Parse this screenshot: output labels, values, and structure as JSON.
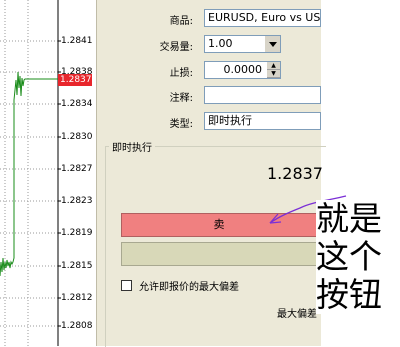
{
  "chart": {
    "tick_labels": [
      "1.2841",
      "1.2838",
      "1.2834",
      "1.2830",
      "1.2827",
      "1.2823",
      "1.2819",
      "1.2815",
      "1.2812",
      "1.2808"
    ],
    "current_price_badge": "1.2837",
    "line_color": "#1a8c1a",
    "badge_color": "#e8262c"
  },
  "order": {
    "symbol_label": "商品:",
    "symbol_value": "EURUSD, Euro vs US D",
    "volume_label": "交易量:",
    "volume_value": "1.00",
    "stoploss_label": "止损:",
    "stoploss_value": "0.0000",
    "comment_label": "注释:",
    "comment_value": "",
    "type_label": "类型:",
    "type_value": "即时执行",
    "group_title": "即时执行",
    "price": "1.2837",
    "sell_label": "卖",
    "buy_label": "",
    "allow_deviation_label": "允许即报价的最大偏差",
    "max_deviation_label": "最大偏差"
  },
  "annotation": {
    "lines": [
      "就是",
      "这个",
      "按钮"
    ],
    "arrow_color": "#7b2fd6"
  }
}
